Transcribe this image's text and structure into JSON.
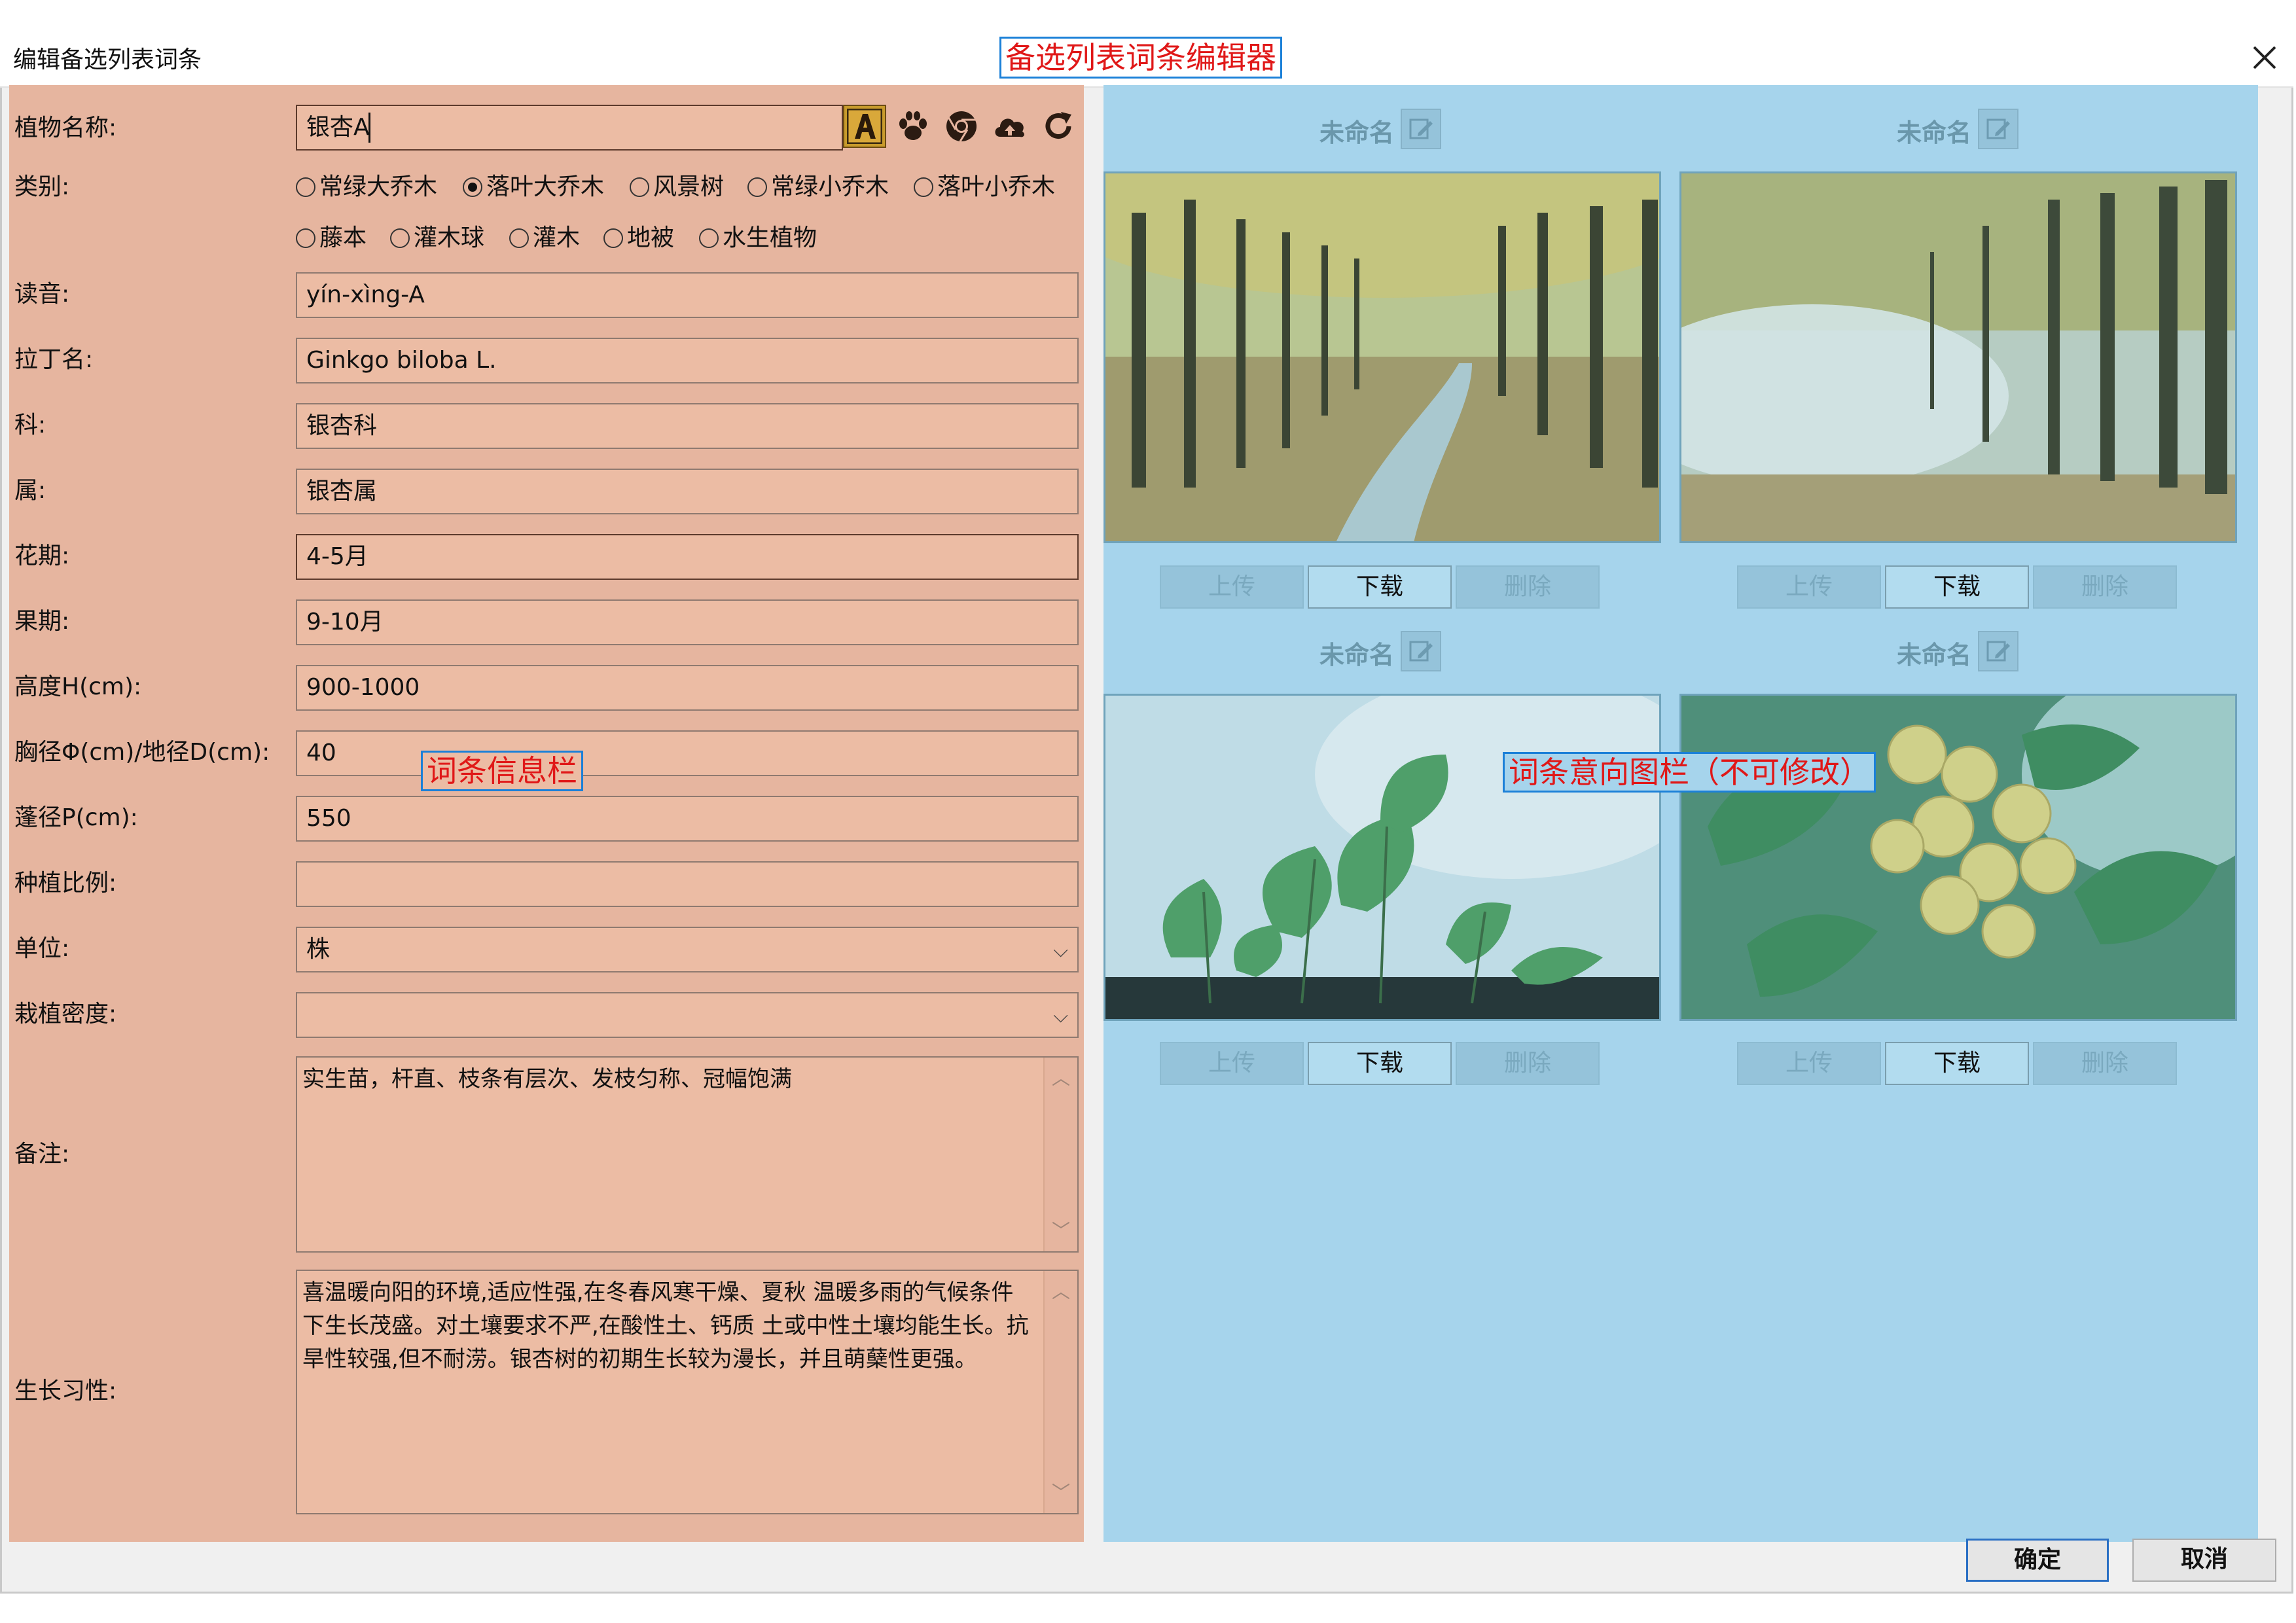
{
  "window": {
    "title": "编辑备选列表词条",
    "editor_annotation": "备选列表词条编辑器",
    "close_glyph": "✕"
  },
  "form": {
    "name_label": "植物名称:",
    "name_value": "银杏A",
    "category_label": "类别:",
    "categories": [
      {
        "label": "常绿大乔木",
        "checked": false
      },
      {
        "label": "落叶大乔木",
        "checked": true
      },
      {
        "label": "风景树",
        "checked": false
      },
      {
        "label": "常绿小乔木",
        "checked": false
      },
      {
        "label": "落叶小乔木",
        "checked": false
      },
      {
        "label": "藤本",
        "checked": false
      },
      {
        "label": "灌木球",
        "checked": false
      },
      {
        "label": "灌木",
        "checked": false
      },
      {
        "label": "地被",
        "checked": false
      },
      {
        "label": "水生植物",
        "checked": false
      }
    ],
    "pinyin_label": "读音:",
    "pinyin_value": "yín-xìng-A",
    "latin_label": "拉丁名:",
    "latin_value": "Ginkgo biloba L.",
    "family_label": "科:",
    "family_value": "银杏科",
    "genus_label": "属:",
    "genus_value": "银杏属",
    "flowering_label": "花期:",
    "flowering_value": "4-5月",
    "fruiting_label": "果期:",
    "fruiting_value": "9-10月",
    "height_label": "高度H(cm):",
    "height_value": "900-1000",
    "diameter_label": "胸径Φ(cm)/地径D(cm):",
    "diameter_value": "40",
    "crown_label": "蓬径P(cm):",
    "crown_value": "550",
    "ratio_label": "种植比例:",
    "ratio_value": "",
    "unit_label": "单位:",
    "unit_value": "株",
    "density_label": "栽植密度:",
    "density_value": "",
    "note_label": "备注:",
    "note_value": "实生苗，杆直、枝条有层次、发枝匀称、冠幅饱满",
    "habit_label": "生长习性:",
    "habit_value": "喜温暖向阳的环境,适应性强,在冬春风寒干燥、夏秋 温暖多雨的气候条件下生长茂盛。对土壤要求不严,在酸性土、钙质 土或中性土壤均能生长。抗旱性较强,但不耐涝。银杏树的初期生长较为漫长，并且萌蘖性更强。",
    "info_annotation": "词条信息栏"
  },
  "toolbar": {
    "icons": [
      "text-a-icon",
      "paw-icon",
      "chrome-icon",
      "cloud-upload-icon",
      "refresh-icon"
    ]
  },
  "images": {
    "annotation": "词条意向图栏（不可修改）",
    "items": [
      {
        "name": "未命名",
        "upload": "上传",
        "download": "下载",
        "delete": "删除"
      },
      {
        "name": "未命名",
        "upload": "上传",
        "download": "下载",
        "delete": "删除"
      },
      {
        "name": "未命名",
        "upload": "上传",
        "download": "下载",
        "delete": "删除"
      },
      {
        "name": "未命名",
        "upload": "上传",
        "download": "下载",
        "delete": "删除"
      }
    ]
  },
  "footer": {
    "confirm": "确定",
    "cancel": "取消"
  },
  "colors": {
    "left_panel": "#e6b59f",
    "right_panel": "#a6d4ec",
    "annotation_text": "#e01818",
    "annotation_border": "#1b80d8"
  }
}
